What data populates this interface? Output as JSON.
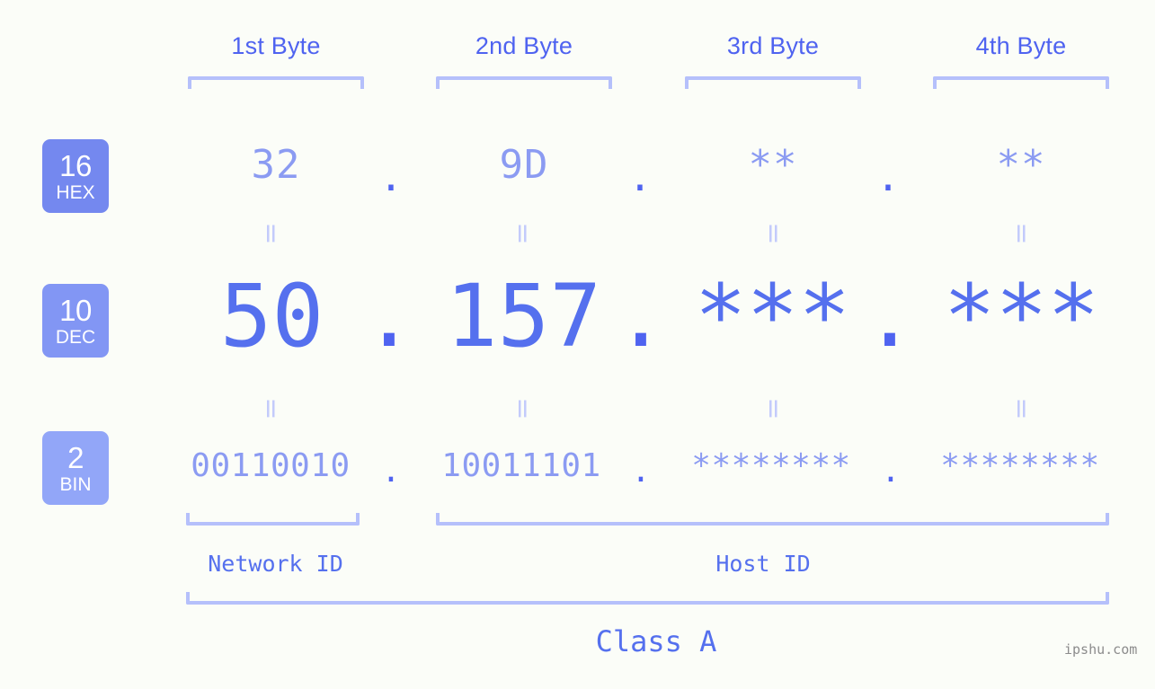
{
  "background_color": "#fbfdf8",
  "accent_color": "#5570ee",
  "accent_light": "#8b9bf2",
  "bracket_color": "#b5c0fb",
  "byte_headers": [
    {
      "label": "1st Byte"
    },
    {
      "label": "2nd Byte"
    },
    {
      "label": "3rd Byte"
    },
    {
      "label": "4th Byte"
    }
  ],
  "rows": {
    "hex": {
      "badge_number": "16",
      "badge_name": "HEX",
      "badge_color": "#7488ef",
      "values": [
        "32",
        "9D",
        "**",
        "**"
      ],
      "separator": "."
    },
    "dec": {
      "badge_number": "10",
      "badge_name": "DEC",
      "badge_color": "#8296f4",
      "values": [
        "50",
        "157",
        "***",
        "***"
      ],
      "separator": "."
    },
    "bin": {
      "badge_number": "2",
      "badge_name": "BIN",
      "badge_color": "#92a6f8",
      "values": [
        "00110010",
        "10011101",
        "********",
        "********"
      ],
      "separator": "."
    }
  },
  "equality_marks": [
    "=",
    "=",
    "=",
    "=",
    "=",
    "=",
    "=",
    "="
  ],
  "id_sections": [
    {
      "label": "Network ID"
    },
    {
      "label": "Host ID"
    }
  ],
  "class_label": "Class A",
  "watermark": "ipshu.com"
}
